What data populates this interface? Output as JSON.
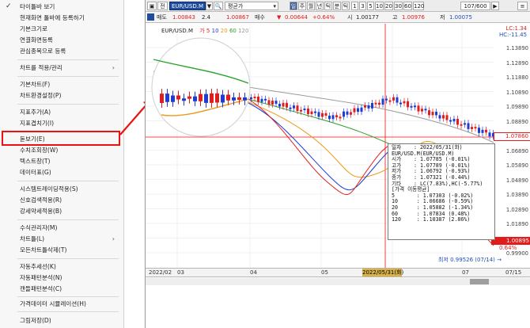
{
  "menu": {
    "items": [
      {
        "label": "타이틀바 보기",
        "checked": true
      },
      {
        "label": "현재화면 툴바에 등록하기"
      },
      {
        "label": "기본크기로"
      },
      {
        "label": "연결화면등록"
      },
      {
        "label": "관심종목으로 등록"
      },
      {
        "label": "차트를 적용/관리",
        "submenu": true
      },
      {
        "label": "기본차트(F)"
      },
      {
        "label": "차트환경설정(P)"
      },
      {
        "label": "지표추가(A)"
      },
      {
        "label": "지표겹치기(I)"
      },
      {
        "label": "돋보기(E)"
      },
      {
        "label": "수치조회창(W)"
      },
      {
        "label": "텍스트창(T)"
      },
      {
        "label": "데이터표(G)"
      },
      {
        "label": "시스템트레이딩적용(S)"
      },
      {
        "label": "신호검색적용(R)"
      },
      {
        "label": "강세약세적용(B)"
      },
      {
        "label": "수식관리자(M)"
      },
      {
        "label": "차트틀(L)",
        "submenu": true
      },
      {
        "label": "모든차트틀삭제(T)"
      },
      {
        "label": "자동추세선(K)"
      },
      {
        "label": "자동패턴분석(N)"
      },
      {
        "label": "캔들패턴분석(C)"
      },
      {
        "label": "가격데이터 시뮬레이션(H)"
      },
      {
        "label": "그림저장(D)"
      }
    ]
  },
  "toolbar": {
    "icon_btn": "▣",
    "jeon": "전",
    "symbol": "EUR/USD.M",
    "dropdown_arrow": "▼",
    "search_icon": "🔍",
    "price_type": "평균가",
    "il": "일",
    "periods": [
      "주",
      "월",
      "년",
      "틱",
      "분",
      "틱"
    ],
    "numbers": [
      "1",
      "3",
      "5",
      "10",
      "20",
      "30",
      "60",
      "120"
    ],
    "count": "107/600",
    "next": "▶",
    "menu_btn": "≡"
  },
  "quote": {
    "sell_label": "매도",
    "sell": "1.00843",
    "qty1": "2.4",
    "buy": "1.00867",
    "buy_label": "매수",
    "down": "▼",
    "change": "0.00644",
    "change_pct": "+0.64%",
    "open_label": "시",
    "open": "1.00177",
    "high_label": "고",
    "high": "1.00976",
    "low_label": "저",
    "low": "1.00075"
  },
  "chart": {
    "legend_symbol": "EUR/USD.M",
    "ma_label": "가",
    "ma_periods": [
      "5",
      "10",
      "20",
      "60",
      "120"
    ],
    "ma_colors": [
      "#e11d1d",
      "#1f3bd6",
      "#ec9a18",
      "#2aa22a",
      "#9a9a9a"
    ],
    "lc": "LC:1.34",
    "hc": "HC:-11.45",
    "y_labels": [
      "1.13890",
      "1.12890",
      "1.11880",
      "1.10890",
      "1.09890",
      "1.08890",
      "1.07860",
      "1.06890",
      "1.05890",
      "1.04890",
      "1.03890",
      "1.02890",
      "1.01890",
      "1.00895",
      "0.99900"
    ],
    "current_price": "1.07860",
    "last_price": "1.00895",
    "last_pct": "0.64%",
    "min_label": "최저 0.99526 (07/14)",
    "x_labels": [
      "2022/02",
      "03",
      "04",
      "05",
      "07",
      "07/15"
    ],
    "x_highlight": "2022/05/31(화)"
  },
  "tooltip": {
    "lines": [
      "일자    : 2022/05/31(화)",
      "EUR/USD.M(EUR/USD.M)",
      "시가    : 1.07785 (-0.01%)",
      "고가    : 1.07789 (-0.01%)",
      "저가    : 1.06792 (-0.93%)",
      "종가    : 1.07321 (-0.44%)",
      "기타    : LC(7.83%),HC(-5.77%)",
      "[가격 이동평균]",
      "5       : 1.07303 (-0.02%)",
      "10      : 1.06686 (-0.59%)",
      "20      : 1.05882 (-1.34%)",
      "60      : 1.07834 (0.48%)",
      "120     : 1.10387 (2.86%)"
    ]
  }
}
